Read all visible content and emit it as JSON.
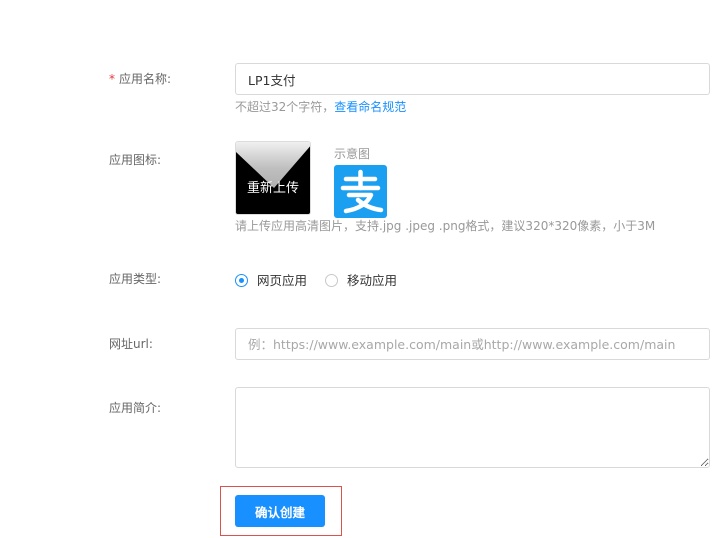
{
  "form": {
    "name": {
      "required_mark": "*",
      "label": "应用名称:",
      "value": "LP1支付",
      "hint_text": "不超过32个字符，",
      "hint_link": "查看命名规范"
    },
    "icon": {
      "label": "应用图标:",
      "reupload_label": "重新上传",
      "sample_label": "示意图",
      "sample_icon": "alipay-zhi-icon",
      "hint": "请上传应用高清图片，支持.jpg .jpeg .png格式，建议320*320像素，小于3M"
    },
    "type": {
      "label": "应用类型:",
      "options": [
        {
          "label": "网页应用",
          "checked": true
        },
        {
          "label": "移动应用",
          "checked": false
        }
      ]
    },
    "url": {
      "label": "网址url:",
      "placeholder": "例：https://www.example.com/main或http://www.example.com/main"
    },
    "intro": {
      "label": "应用简介:",
      "value": ""
    },
    "submit_label": "确认创建"
  },
  "colors": {
    "primary": "#1890ff",
    "required": "#e5383b",
    "highlight_border": "#d9534f",
    "sample_icon_bg": "#1b9ff1"
  }
}
